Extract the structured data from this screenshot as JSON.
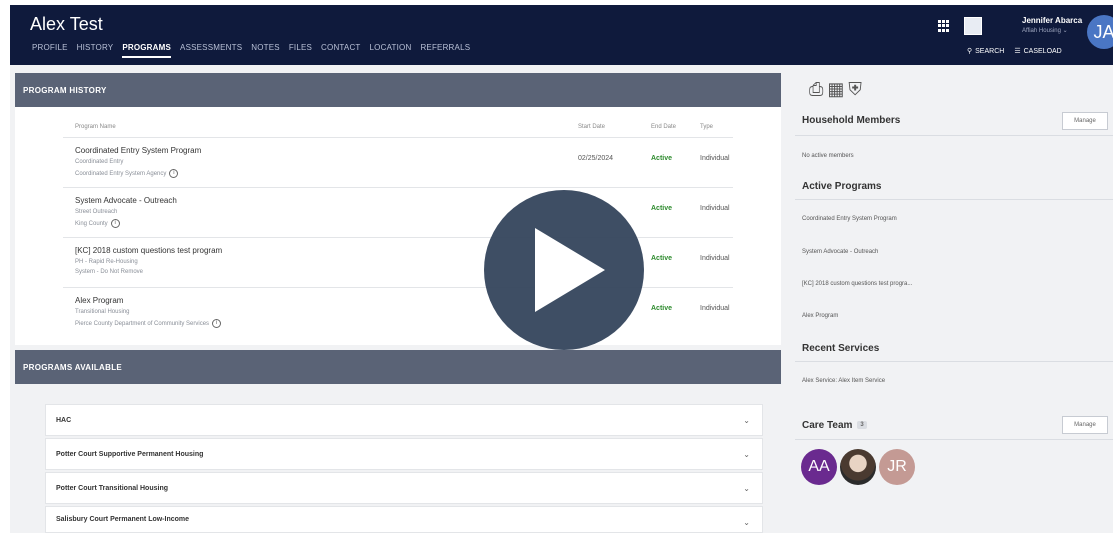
{
  "header": {
    "client_name": "Alex Test",
    "nav": [
      "PROFILE",
      "HISTORY",
      "PROGRAMS",
      "ASSESSMENTS",
      "NOTES",
      "FILES",
      "CONTACT",
      "LOCATION",
      "REFERRALS"
    ],
    "active_nav": "PROGRAMS",
    "user_name": "Jennifer Abarca",
    "user_org": "Affiah Housing",
    "user_initials": "JA",
    "search_label": "SEARCH",
    "caseload_label": "CASELOAD"
  },
  "program_history": {
    "title": "PROGRAM HISTORY",
    "columns": {
      "name": "Program Name",
      "start": "Start Date",
      "end": "End Date",
      "type": "Type"
    },
    "rows": [
      {
        "name": "Coordinated Entry System Program",
        "sub1": "Coordinated Entry",
        "sub2": "Coordinated Entry System Agency",
        "start": "02/25/2024",
        "end": "Active",
        "type": "Individual"
      },
      {
        "name": "System Advocate - Outreach",
        "sub1": "Street Outreach",
        "sub2": "King County",
        "start": "",
        "end": "Active",
        "type": "Individual"
      },
      {
        "name": "[KC] 2018 custom questions test program",
        "sub1": "PH - Rapid Re-Housing",
        "sub2": "System - Do Not Remove",
        "start": "",
        "end": "Active",
        "type": "Individual"
      },
      {
        "name": "Alex Program",
        "sub1": "Transitional Housing",
        "sub2": "Pierce County Department of Community Services",
        "start": "",
        "end": "Active",
        "type": "Individual"
      }
    ]
  },
  "programs_available": {
    "title": "PROGRAMS AVAILABLE",
    "items": [
      "HAC",
      "Potter Court Supportive Permanent Housing",
      "Potter Court Transitional Housing",
      "Salisbury Court Permanent Low-Income"
    ]
  },
  "sidebar": {
    "household_title": "Household Members",
    "manage_label": "Manage",
    "household_text": "No active members",
    "active_programs_title": "Active Programs",
    "active_programs": [
      "Coordinated Entry System Program",
      "System Advocate - Outreach",
      "[KC] 2018 custom questions test progra...",
      "Alex Program"
    ],
    "recent_services_title": "Recent Services",
    "recent_services": [
      "Alex Service: Alex Item Service"
    ],
    "care_team_title": "Care Team",
    "care_team_count": "3",
    "care_team": [
      "AA",
      "",
      "JR"
    ]
  },
  "icons": [
    "print-icon",
    "calendar-icon",
    "shield-icon",
    "grid-icon",
    "search-icon",
    "menu-icon",
    "chevron-down-icon",
    "info-icon",
    "play-icon"
  ]
}
